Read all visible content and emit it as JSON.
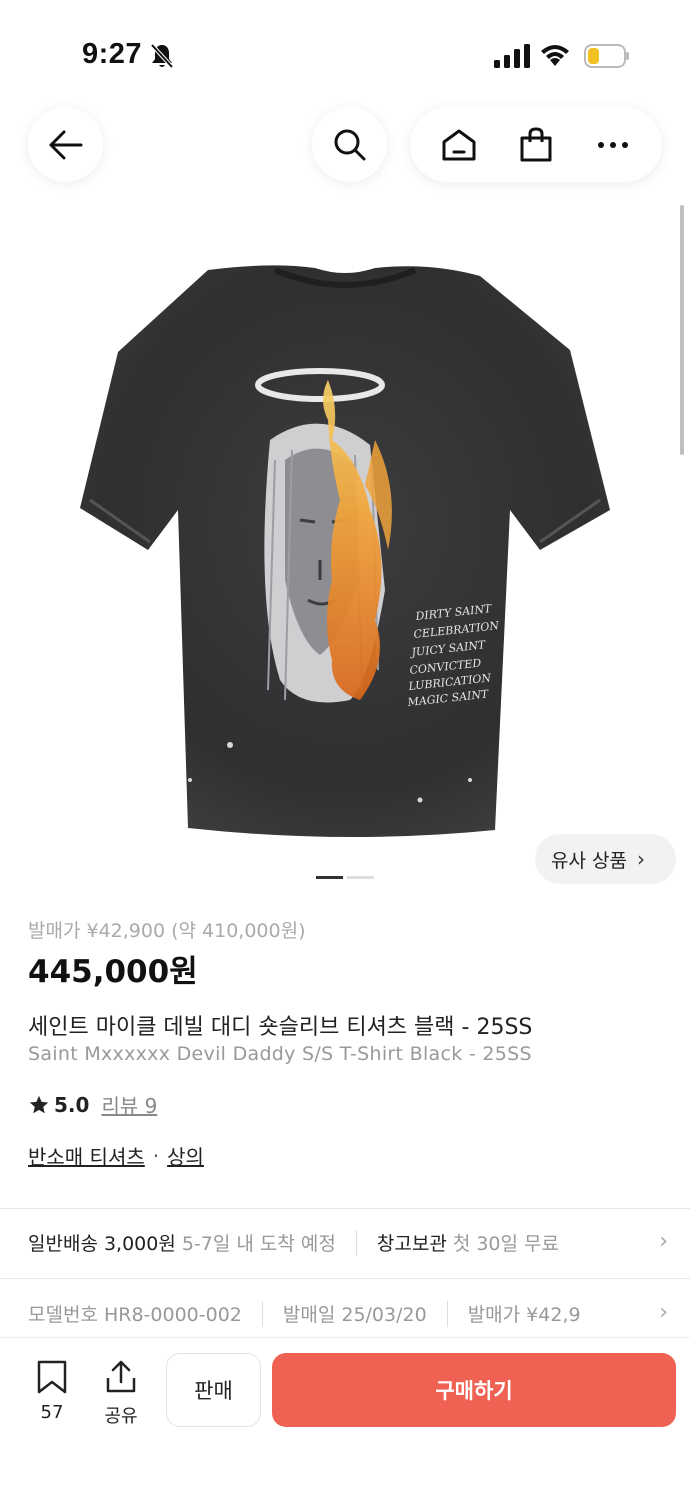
{
  "status_bar": {
    "time": "9:27"
  },
  "header": {
    "icons": [
      "back-arrow-icon",
      "search-icon",
      "home-icon",
      "shopping-bag-icon",
      "more-icon"
    ]
  },
  "gallery": {
    "similar_products_label": "유사 상품",
    "page_count": 2,
    "current_page": 1,
    "print_text": [
      "DIRTY SAINT",
      "CELEBRATION",
      "JUICY SAINT",
      "CONVICTED",
      "LUBRICATION",
      "MAGIC SAINT"
    ]
  },
  "product": {
    "release_price": "발매가 ¥42,900 (약 410,000원)",
    "price": "445,000원",
    "name_ko": "세인트 마이클 데빌 대디 숏슬리브 티셔츠 블랙 - 25SS",
    "name_en": "Saint Mxxxxxx Devil Daddy S/S T-Shirt Black - 25SS",
    "rating": "5.0",
    "review_label": "리뷰 9",
    "category_primary": "반소매 티셔츠",
    "category_secondary": "상의"
  },
  "shipping": {
    "standard_label": "일반배송 3,000원",
    "standard_eta": "5-7일 내 도착 예정",
    "warehouse_label": "창고보관",
    "warehouse_note": "첫 30일 무료"
  },
  "specs": {
    "model": "모델번호 HR8-0000-002",
    "release_date": "발매일 25/03/20",
    "release_price_short": "발매가 ¥42,9"
  },
  "bottom_bar": {
    "bookmark_count": "57",
    "share_label": "공유",
    "sell_label": "판매",
    "buy_label": "구매하기"
  },
  "colors": {
    "accent": "#ef6253",
    "text_primary": "#222222",
    "text_secondary": "#999999"
  }
}
